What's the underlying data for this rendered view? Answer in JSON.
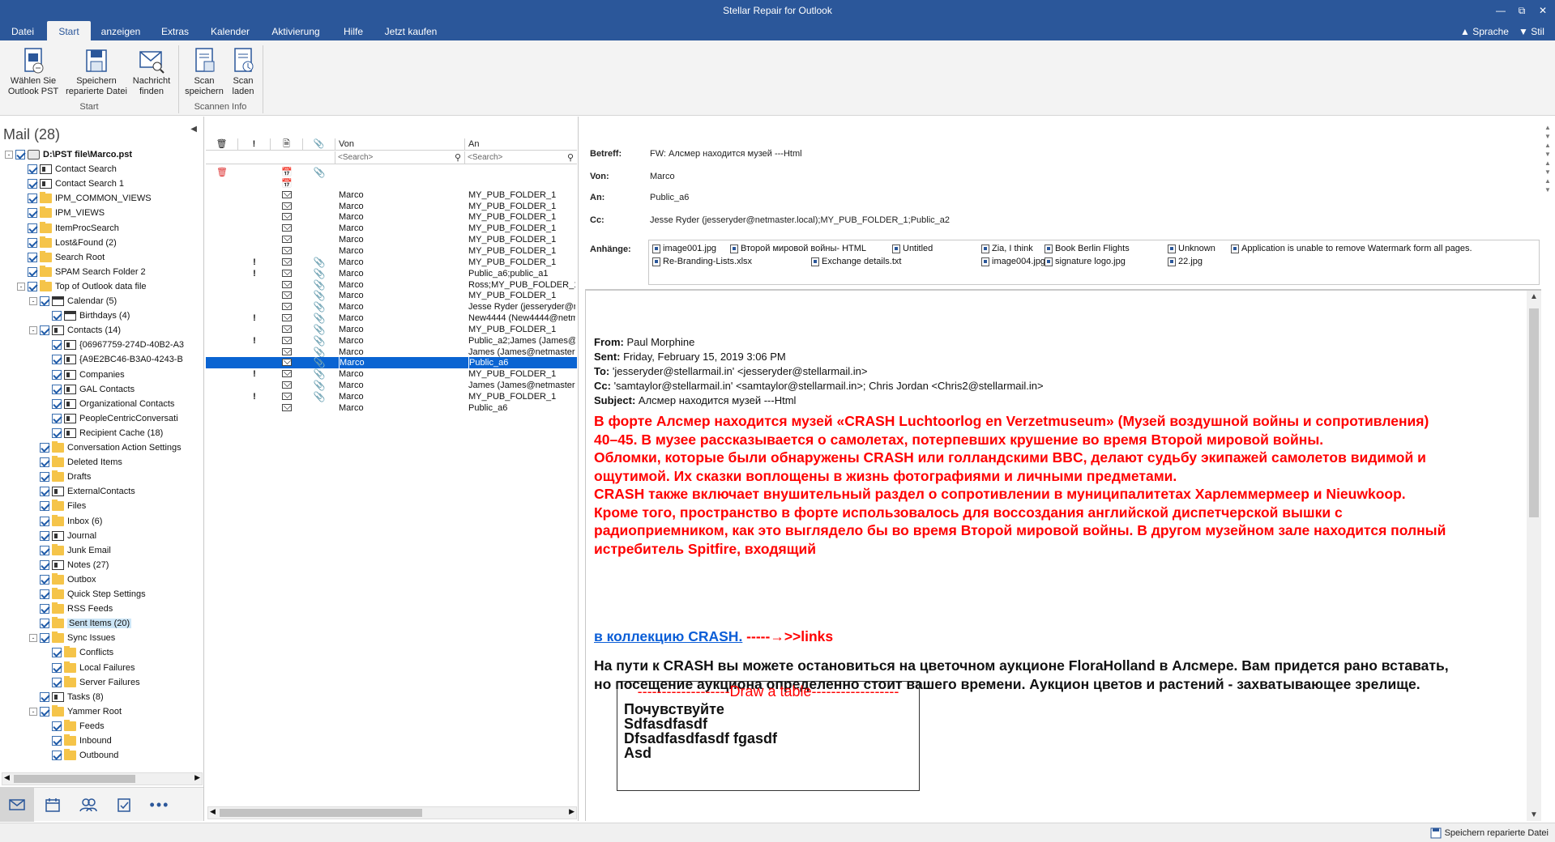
{
  "window": {
    "title": "Stellar Repair for Outlook"
  },
  "menu": {
    "tabs": [
      "Datei",
      "Start",
      "anzeigen",
      "Extras",
      "Kalender",
      "Aktivierung",
      "Hilfe",
      "Jetzt kaufen"
    ],
    "active": "Start",
    "right": {
      "language": "Sprache",
      "style": "Stil"
    }
  },
  "ribbon": {
    "buttons": [
      {
        "label": "Wählen Sie\nOutlook PST"
      },
      {
        "label": "Speichern\nreparierte Datei"
      },
      {
        "label": "Nachricht\nfinden"
      },
      {
        "label": "Scan\nspeichern"
      },
      {
        "label": "Scan\nladen"
      }
    ],
    "groups": [
      "Start",
      "Scannen Info"
    ]
  },
  "leftpane": {
    "header": "Mail (28)",
    "tree": [
      {
        "label": "D:\\PST file\\Marco.pst",
        "level": 0,
        "icon": "pst",
        "bold": true,
        "exp": "-"
      },
      {
        "label": "Contact Search",
        "level": 1,
        "icon": "contact"
      },
      {
        "label": "Contact Search 1",
        "level": 1,
        "icon": "contact"
      },
      {
        "label": "IPM_COMMON_VIEWS",
        "level": 1,
        "icon": "folder"
      },
      {
        "label": "IPM_VIEWS",
        "level": 1,
        "icon": "folder"
      },
      {
        "label": "ItemProcSearch",
        "level": 1,
        "icon": "folder"
      },
      {
        "label": "Lost&Found (2)",
        "level": 1,
        "icon": "folder"
      },
      {
        "label": "Search Root",
        "level": 1,
        "icon": "folder"
      },
      {
        "label": "SPAM Search Folder 2",
        "level": 1,
        "icon": "folder"
      },
      {
        "label": "Top of Outlook data file",
        "level": 1,
        "icon": "folder",
        "exp": "-"
      },
      {
        "label": "Calendar (5)",
        "level": 2,
        "icon": "calendar",
        "exp": "-"
      },
      {
        "label": "Birthdays (4)",
        "level": 3,
        "icon": "calendar"
      },
      {
        "label": "Contacts (14)",
        "level": 2,
        "icon": "contact",
        "exp": "-"
      },
      {
        "label": "{06967759-274D-40B2-A3",
        "level": 3,
        "icon": "contact"
      },
      {
        "label": "{A9E2BC46-B3A0-4243-B",
        "level": 3,
        "icon": "contact"
      },
      {
        "label": "Companies",
        "level": 3,
        "icon": "contact"
      },
      {
        "label": "GAL Contacts",
        "level": 3,
        "icon": "contact"
      },
      {
        "label": "Organizational Contacts",
        "level": 3,
        "icon": "contact"
      },
      {
        "label": "PeopleCentricConversati",
        "level": 3,
        "icon": "contact"
      },
      {
        "label": "Recipient Cache (18)",
        "level": 3,
        "icon": "contact"
      },
      {
        "label": "Conversation Action Settings",
        "level": 2,
        "icon": "folder"
      },
      {
        "label": "Deleted Items",
        "level": 2,
        "icon": "folder"
      },
      {
        "label": "Drafts",
        "level": 2,
        "icon": "folder"
      },
      {
        "label": "ExternalContacts",
        "level": 2,
        "icon": "contact"
      },
      {
        "label": "Files",
        "level": 2,
        "icon": "folder"
      },
      {
        "label": "Inbox (6)",
        "level": 2,
        "icon": "folder"
      },
      {
        "label": "Journal",
        "level": 2,
        "icon": "contact"
      },
      {
        "label": "Junk Email",
        "level": 2,
        "icon": "folder"
      },
      {
        "label": "Notes (27)",
        "level": 2,
        "icon": "contact"
      },
      {
        "label": "Outbox",
        "level": 2,
        "icon": "folder"
      },
      {
        "label": "Quick Step Settings",
        "level": 2,
        "icon": "folder"
      },
      {
        "label": "RSS Feeds",
        "level": 2,
        "icon": "folder"
      },
      {
        "label": "Sent Items (20)",
        "level": 2,
        "icon": "folder",
        "sel": true
      },
      {
        "label": "Sync Issues",
        "level": 2,
        "icon": "folder",
        "exp": "-"
      },
      {
        "label": "Conflicts",
        "level": 3,
        "icon": "folder"
      },
      {
        "label": "Local Failures",
        "level": 3,
        "icon": "folder"
      },
      {
        "label": "Server Failures",
        "level": 3,
        "icon": "folder"
      },
      {
        "label": "Tasks (8)",
        "level": 2,
        "icon": "contact"
      },
      {
        "label": "Yammer Root",
        "level": 2,
        "icon": "folder",
        "exp": "-"
      },
      {
        "label": "Feeds",
        "level": 3,
        "icon": "folder"
      },
      {
        "label": "Inbound",
        "level": 3,
        "icon": "folder"
      },
      {
        "label": "Outbound",
        "level": 3,
        "icon": "folder"
      }
    ],
    "nav": [
      "mail",
      "calendar",
      "contacts",
      "tasks",
      "more"
    ]
  },
  "list": {
    "columns": {
      "from": "Von",
      "to": "An"
    },
    "search_placeholder": "<Search>",
    "rows": [
      {
        "deleted": true,
        "important": false,
        "type": "calendar",
        "attach": true,
        "from": "",
        "to": ""
      },
      {
        "important": false,
        "type": "calendar",
        "attach": false,
        "from": "",
        "to": ""
      },
      {
        "important": false,
        "type": "mail",
        "attach": false,
        "from": "Marco",
        "to": "MY_PUB_FOLDER_1"
      },
      {
        "important": false,
        "type": "mail",
        "attach": false,
        "from": "Marco",
        "to": "MY_PUB_FOLDER_1"
      },
      {
        "important": false,
        "type": "mail",
        "attach": false,
        "from": "Marco",
        "to": "MY_PUB_FOLDER_1"
      },
      {
        "important": false,
        "type": "mail",
        "attach": false,
        "from": "Marco",
        "to": "MY_PUB_FOLDER_1"
      },
      {
        "important": false,
        "type": "mail",
        "attach": false,
        "from": "Marco",
        "to": "MY_PUB_FOLDER_1"
      },
      {
        "important": false,
        "type": "mail",
        "attach": false,
        "from": "Marco",
        "to": "MY_PUB_FOLDER_1"
      },
      {
        "important": true,
        "type": "mail",
        "attach": true,
        "from": "Marco",
        "to": "MY_PUB_FOLDER_1"
      },
      {
        "important": true,
        "type": "mail",
        "attach": true,
        "from": "Marco",
        "to": "Public_a6;public_a1"
      },
      {
        "important": false,
        "type": "mail",
        "attach": true,
        "from": "Marco",
        "to": "Ross;MY_PUB_FOLDER_1"
      },
      {
        "important": false,
        "type": "mail",
        "attach": true,
        "from": "Marco",
        "to": "MY_PUB_FOLDER_1"
      },
      {
        "important": false,
        "type": "mail",
        "attach": true,
        "from": "Marco",
        "to": "Jesse Ryder (jesseryder@ne"
      },
      {
        "important": true,
        "type": "mail",
        "attach": true,
        "from": "Marco",
        "to": "New4444 (New4444@netm"
      },
      {
        "important": false,
        "type": "mail",
        "attach": true,
        "from": "Marco",
        "to": "MY_PUB_FOLDER_1"
      },
      {
        "important": true,
        "type": "mail",
        "attach": true,
        "from": "Marco",
        "to": "Public_a2;James (James@n"
      },
      {
        "important": false,
        "type": "mail",
        "attach": true,
        "from": "Marco",
        "to": "James (James@netmaster.lo"
      },
      {
        "important": false,
        "type": "mail",
        "attach": true,
        "from": "Marco",
        "to": "Public_a6",
        "sel": true
      },
      {
        "important": true,
        "type": "mail",
        "attach": true,
        "from": "Marco",
        "to": "MY_PUB_FOLDER_1"
      },
      {
        "important": false,
        "type": "mail",
        "attach": true,
        "from": "Marco",
        "to": "James (James@netmaster.lo"
      },
      {
        "important": true,
        "type": "mail",
        "attach": true,
        "from": "Marco",
        "to": "MY_PUB_FOLDER_1"
      },
      {
        "important": false,
        "type": "mail",
        "attach": false,
        "from": "Marco",
        "to": "Public_a6"
      }
    ]
  },
  "reading": {
    "labels": {
      "subject": "Betreff:",
      "from": "Von:",
      "to": "An:",
      "cc": "Cc:",
      "attachments": "Anhänge:"
    },
    "subject": "FW: Алсмер находится музей ---Html",
    "from": "Marco",
    "to": "Public_a6",
    "cc": "Jesse Ryder (jesseryder@netmaster.local);MY_PUB_FOLDER_1;Public_a2",
    "attachments_row1": [
      "image001.jpg",
      "Второй мировой войны- HTML",
      "Untitled",
      "Zia, I think",
      "Book Berlin Flights",
      "Unknown",
      "Application is unable to remove Watermark form all pages."
    ],
    "attachments_row2": [
      "Re-Branding-Lists.xlsx",
      "Exchange details.txt",
      "image004.jpg",
      "signature logo.jpg",
      "22.jpg"
    ],
    "body": {
      "from_label": "From:",
      "from": "Paul Morphine",
      "sent_label": "Sent:",
      "sent": "Friday, February 15, 2019 3:06 PM",
      "to_label": "To:",
      "to": "'jesseryder@stellarmail.in' <jesseryder@stellarmail.in>",
      "cc_label": "Cc:",
      "cc": "'samtaylor@stellarmail.in' <samtaylor@stellarmail.in>; Chris Jordan <Chris2@stellarmail.in>",
      "subject_label": "Subject:",
      "subject": "Алсмер находится музей ---Html",
      "red_lines": [
        "В форте Алсмер находится музей «CRASH Luchtoorlog en Verzetmuseum» (Музей воздушной войны и сопротивления)",
        "40–45. В музее рассказывается о самолетах, потерпевших крушение во время Второй мировой войны.",
        "Обломки, которые были обнаружены CRASH или голландскими BBC, делают судьбу экипажей самолетов видимой и",
        "ощутимой. Их сказки воплощены в жизнь фотографиями и личными предметами.",
        "CRASH также включает внушительный раздел о сопротивлении в муниципалитетах Харлеммермеер и Nieuwkoop.",
        "Кроме того, пространство в форте использовалось для воссоздания английской диспетчерской вышки с",
        "радиоприемником, как это выглядело бы во время Второй мировой войны. В другом музейном зале находится полный",
        "истребитель Spitfire, входящий"
      ],
      "link": "в коллекцию CRASH.",
      "link_suffix": " -----→>>links",
      "black_lines": [
        "На пути к CRASH вы можете остановиться на цветочном аукционе FloraHolland в Алсмере. Вам придется рано вставать,",
        "но посещение аукциона определенно стоит вашего времени. Аукцион цветов и растений - захватывающее зрелище."
      ],
      "table_header": "-------------------Draw a table------------------",
      "table_rows": [
        "Почувствуйте",
        "Sdfasdfasdf",
        "Dfsadfasdfasdf fgasdf",
        "Asd"
      ]
    }
  },
  "status": {
    "save": "Speichern reparierte Datei"
  },
  "colors": {
    "accent": "#2b579a",
    "selection": "#0a64d2",
    "red_text": "#ff0000",
    "link": "#0b5ed7"
  }
}
